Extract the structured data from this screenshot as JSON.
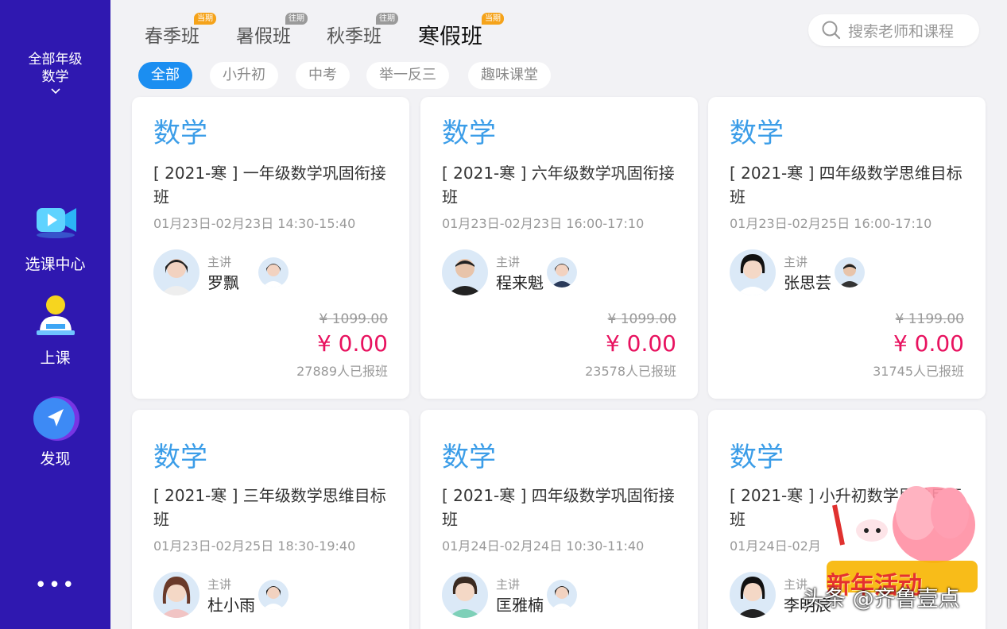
{
  "sidebar": {
    "grade": "全部年级",
    "subject": "数学",
    "nav": [
      {
        "label": "选课中心",
        "icon": "video-icon"
      },
      {
        "label": "上课",
        "icon": "student-desk-icon"
      },
      {
        "label": "发现",
        "icon": "compass-icon"
      }
    ],
    "more": "•••"
  },
  "tabs": [
    {
      "label": "春季班",
      "badge": "当期",
      "badge_type": "current"
    },
    {
      "label": "暑假班",
      "badge": "往期",
      "badge_type": "past"
    },
    {
      "label": "秋季班",
      "badge": "往期",
      "badge_type": "past"
    },
    {
      "label": "寒假班",
      "badge": "当期",
      "badge_type": "current",
      "active": true
    }
  ],
  "search": {
    "placeholder": "搜索老师和课程"
  },
  "chips": [
    {
      "label": "全部",
      "active": true
    },
    {
      "label": "小升初"
    },
    {
      "label": "中考"
    },
    {
      "label": "举一反三"
    },
    {
      "label": "趣味课堂"
    }
  ],
  "cards": [
    {
      "subject": "数学",
      "title": "[ 2021-寒 ] 一年级数学巩固衔接班",
      "time": "01月23日-02月23日 14:30-15:40",
      "role": "主讲",
      "teacher": "罗飘",
      "old_price": "¥ 1099.00",
      "price": "¥ 0.00",
      "enrolled": "27889人已报班"
    },
    {
      "subject": "数学",
      "title": "[ 2021-寒 ] 六年级数学巩固衔接班",
      "time": "01月23日-02月23日 16:00-17:10",
      "role": "主讲",
      "teacher": "程来魁",
      "old_price": "¥ 1099.00",
      "price": "¥ 0.00",
      "enrolled": "23578人已报班"
    },
    {
      "subject": "数学",
      "title": "[ 2021-寒 ] 四年级数学思维目标班",
      "time": "01月23日-02月25日 16:00-17:10",
      "role": "主讲",
      "teacher": "张思芸",
      "old_price": "¥ 1199.00",
      "price": "¥ 0.00",
      "enrolled": "31745人已报班"
    },
    {
      "subject": "数学",
      "title": "[ 2021-寒 ] 三年级数学思维目标班",
      "time": "01月23日-02月25日 18:30-19:40",
      "role": "主讲",
      "teacher": "杜小雨"
    },
    {
      "subject": "数学",
      "title": "[ 2021-寒 ] 四年级数学巩固衔接班",
      "time": "01月24日-02月24日 10:30-11:40",
      "role": "主讲",
      "teacher": "匡雅楠"
    },
    {
      "subject": "数学",
      "title": "[ 2021-寒 ] 小升初数学思维目标班",
      "time": "01月24日-02月",
      "role": "主讲",
      "teacher": "李明辰"
    }
  ],
  "promo": {
    "label": "新年活动"
  },
  "watermark": "头条 @齐鲁壹点",
  "colors": {
    "sidebar": "#2f18b0",
    "accent": "#1b8ef1",
    "price": "#e8125f",
    "subject": "#3b9de8"
  }
}
